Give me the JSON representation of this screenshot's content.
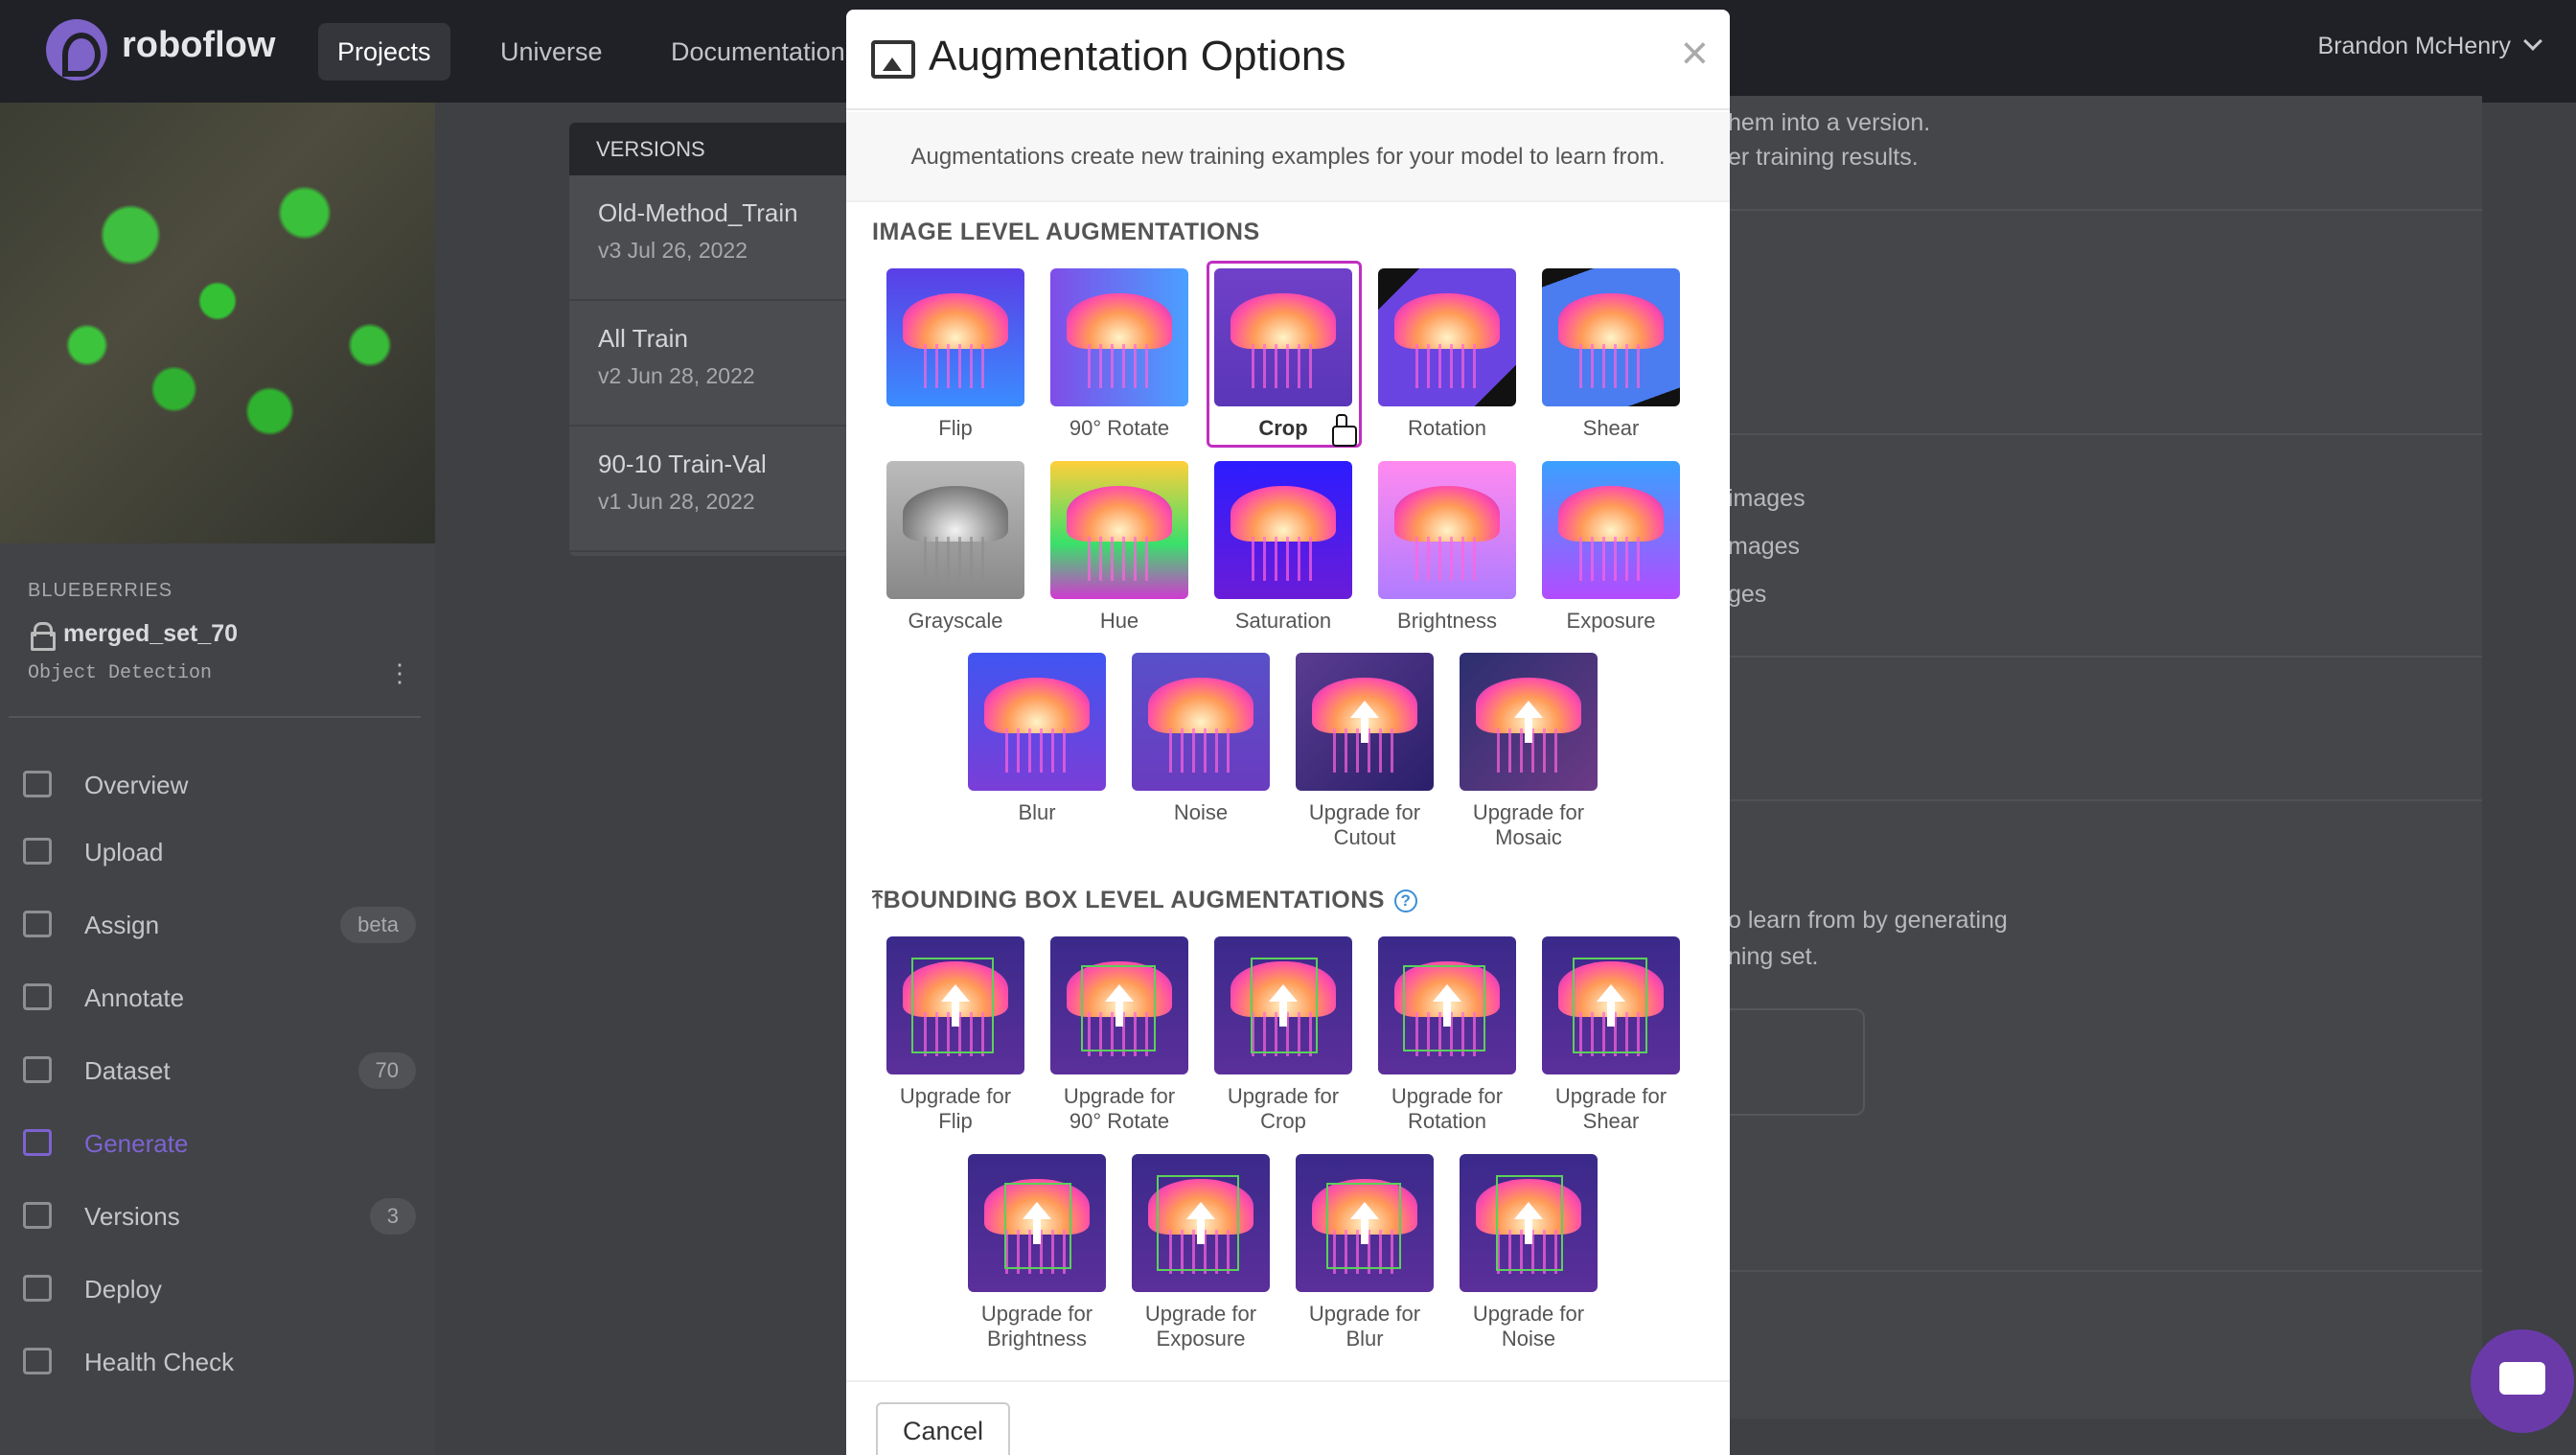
{
  "nav": {
    "brand": "roboflow",
    "items": [
      "Projects",
      "Universe",
      "Documentation"
    ],
    "user": "Brandon McHenry"
  },
  "project": {
    "workspace": "BLUEBERRIES",
    "name": "merged_set_70",
    "type": "Object Detection"
  },
  "sidebar": {
    "items": [
      {
        "label": "Overview",
        "icon": "overview-icon"
      },
      {
        "label": "Upload",
        "icon": "upload-icon"
      },
      {
        "label": "Assign",
        "icon": "search-icon",
        "badge": "beta"
      },
      {
        "label": "Annotate",
        "icon": "annotate-icon"
      },
      {
        "label": "Dataset",
        "icon": "dataset-icon",
        "badge": "70"
      },
      {
        "label": "Generate",
        "icon": "generate-icon",
        "active": true
      },
      {
        "label": "Versions",
        "icon": "versions-icon",
        "badge": "3"
      },
      {
        "label": "Deploy",
        "icon": "rocket-icon"
      },
      {
        "label": "Health Check",
        "icon": "stethoscope-icon"
      }
    ]
  },
  "versions": {
    "header": "VERSIONS",
    "items": [
      {
        "title": "Old-Method_Train",
        "date": "v3 Jul 26, 2022"
      },
      {
        "title": "All Train",
        "date": "v2 Jun 28, 2022"
      },
      {
        "title": "90-10 Train-Val",
        "date": "v1 Jun 28, 2022"
      }
    ]
  },
  "background_text": {
    "line1": "hem into a version.",
    "line2": "er training results.",
    "img1": "images",
    "img2": "mages",
    "img3": "ges",
    "learn1": "o learn from by generating",
    "learn2": "ning set."
  },
  "modal": {
    "title": "Augmentation Options",
    "subtitle": "Augmentations create new training examples for your model to learn from.",
    "image_section": "IMAGE LEVEL AUGMENTATIONS",
    "bbox_section": "BOUNDING BOX LEVEL AUGMENTATIONS",
    "cancel": "Cancel",
    "image_tiles": [
      {
        "label": "Flip"
      },
      {
        "label": "90° Rotate"
      },
      {
        "label": "Crop",
        "selected": true
      },
      {
        "label": "Rotation"
      },
      {
        "label": "Shear"
      },
      {
        "label": "Grayscale"
      },
      {
        "label": "Hue"
      },
      {
        "label": "Saturation"
      },
      {
        "label": "Brightness"
      },
      {
        "label": "Exposure"
      },
      {
        "label": "Blur"
      },
      {
        "label": "Noise"
      },
      {
        "label": "Upgrade for Cutout",
        "locked": true
      },
      {
        "label": "Upgrade for Mosaic",
        "locked": true
      }
    ],
    "bbox_tiles": [
      {
        "label": "Upgrade for Flip"
      },
      {
        "label": "Upgrade for 90° Rotate"
      },
      {
        "label": "Upgrade for Crop"
      },
      {
        "label": "Upgrade for Rotation"
      },
      {
        "label": "Upgrade for Shear"
      },
      {
        "label": "Upgrade for Brightness"
      },
      {
        "label": "Upgrade for Exposure"
      },
      {
        "label": "Upgrade for Blur"
      },
      {
        "label": "Upgrade for Noise"
      }
    ]
  },
  "colors": {
    "accent": "#7d63d1",
    "selected_border": "#c02fc0"
  }
}
